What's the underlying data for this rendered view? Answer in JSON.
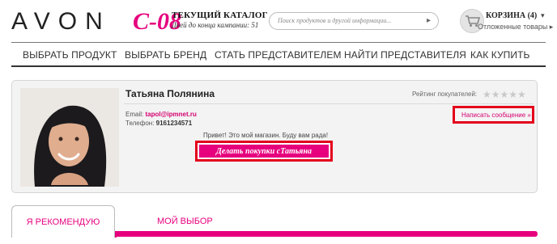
{
  "header": {
    "logo_text": "AVON",
    "campaign_code": "C-08",
    "catalog_title": "ТЕКУЩИЙ КАТАЛОГ",
    "catalog_subtitle": "Дней до конца кампании: 51",
    "search_placeholder": "Поиск продуктов и другой информации...",
    "search_arrow": "▸",
    "cart_title": "КОРЗИНА (4)",
    "cart_caret": "▾",
    "cart_deferred": "Отложенные товары ▸"
  },
  "nav": {
    "items": [
      "ВЫБРАТЬ ПРОДУКТ",
      "ВЫБРАТЬ БРЕНД",
      "СТАТЬ ПРЕДСТАВИТЕЛЕМ",
      "НАЙТИ ПРЕДСТАВИТЕЛЯ",
      "КАК КУПИТЬ"
    ]
  },
  "profile": {
    "name": "Татьяна Полянина",
    "rating_label": "Рейтинг покупателей:",
    "stars": "★★★★★",
    "stars_filled": 0,
    "stars_total": 5,
    "email_label": "Email:",
    "email_value": "tapol@ipmnet.ru",
    "phone_label": "Телефон:",
    "phone_value": "9161234571",
    "message_link": "Написать сообщение »",
    "greeting": "Привет! Это мой магазин. Буду вам рада!",
    "shop_button": "Делать покупки сТатьяна"
  },
  "tabs": {
    "items": [
      "Я РЕКОМЕНДУЮ",
      "МОЙ ВЫБОР"
    ],
    "active": "Я РЕКОМЕНДУЮ"
  },
  "colors": {
    "brand_pink": "#e6007e",
    "highlight_red": "#e3001b",
    "panel_bg": "#f3f3f3"
  }
}
